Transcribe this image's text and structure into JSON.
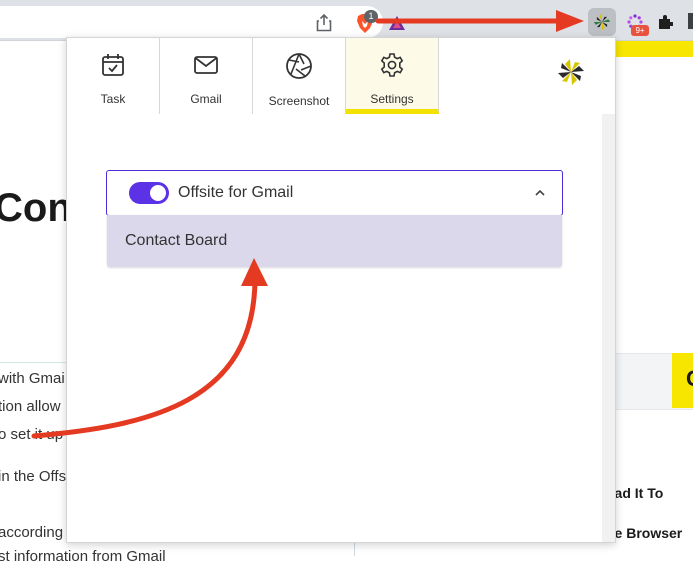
{
  "browser": {
    "brave_badge": "1",
    "ext_badge": "9+",
    "icons": [
      "share-icon",
      "brave-shields-icon",
      "brave-rewards-icon",
      "offsite-extension-icon",
      "extension-dots-icon",
      "puzzle-icon"
    ]
  },
  "background_page": {
    "heading": "Cont",
    "lines": [
      "with Gmai",
      "tion allow",
      "o set it up",
      "in the Offs",
      "according",
      "st information from Gmail"
    ],
    "right_lines": [
      "oad It To",
      "he Browser"
    ]
  },
  "popup": {
    "tabs": [
      {
        "label": "Task",
        "icon": "calendar-check-icon"
      },
      {
        "label": "Gmail",
        "icon": "mail-icon"
      },
      {
        "label": "Screenshot",
        "icon": "camera-aperture-icon"
      },
      {
        "label": "Settings",
        "icon": "gear-icon",
        "active": true
      }
    ],
    "select": {
      "label": "Offsite for Gmail",
      "toggle_on": true
    },
    "option": {
      "label": "Contact Board"
    }
  },
  "colors": {
    "accent": "#5b32e6",
    "highlight": "#f3e100",
    "option_bg": "#dcd8ec",
    "arrow": "#e53a22"
  }
}
